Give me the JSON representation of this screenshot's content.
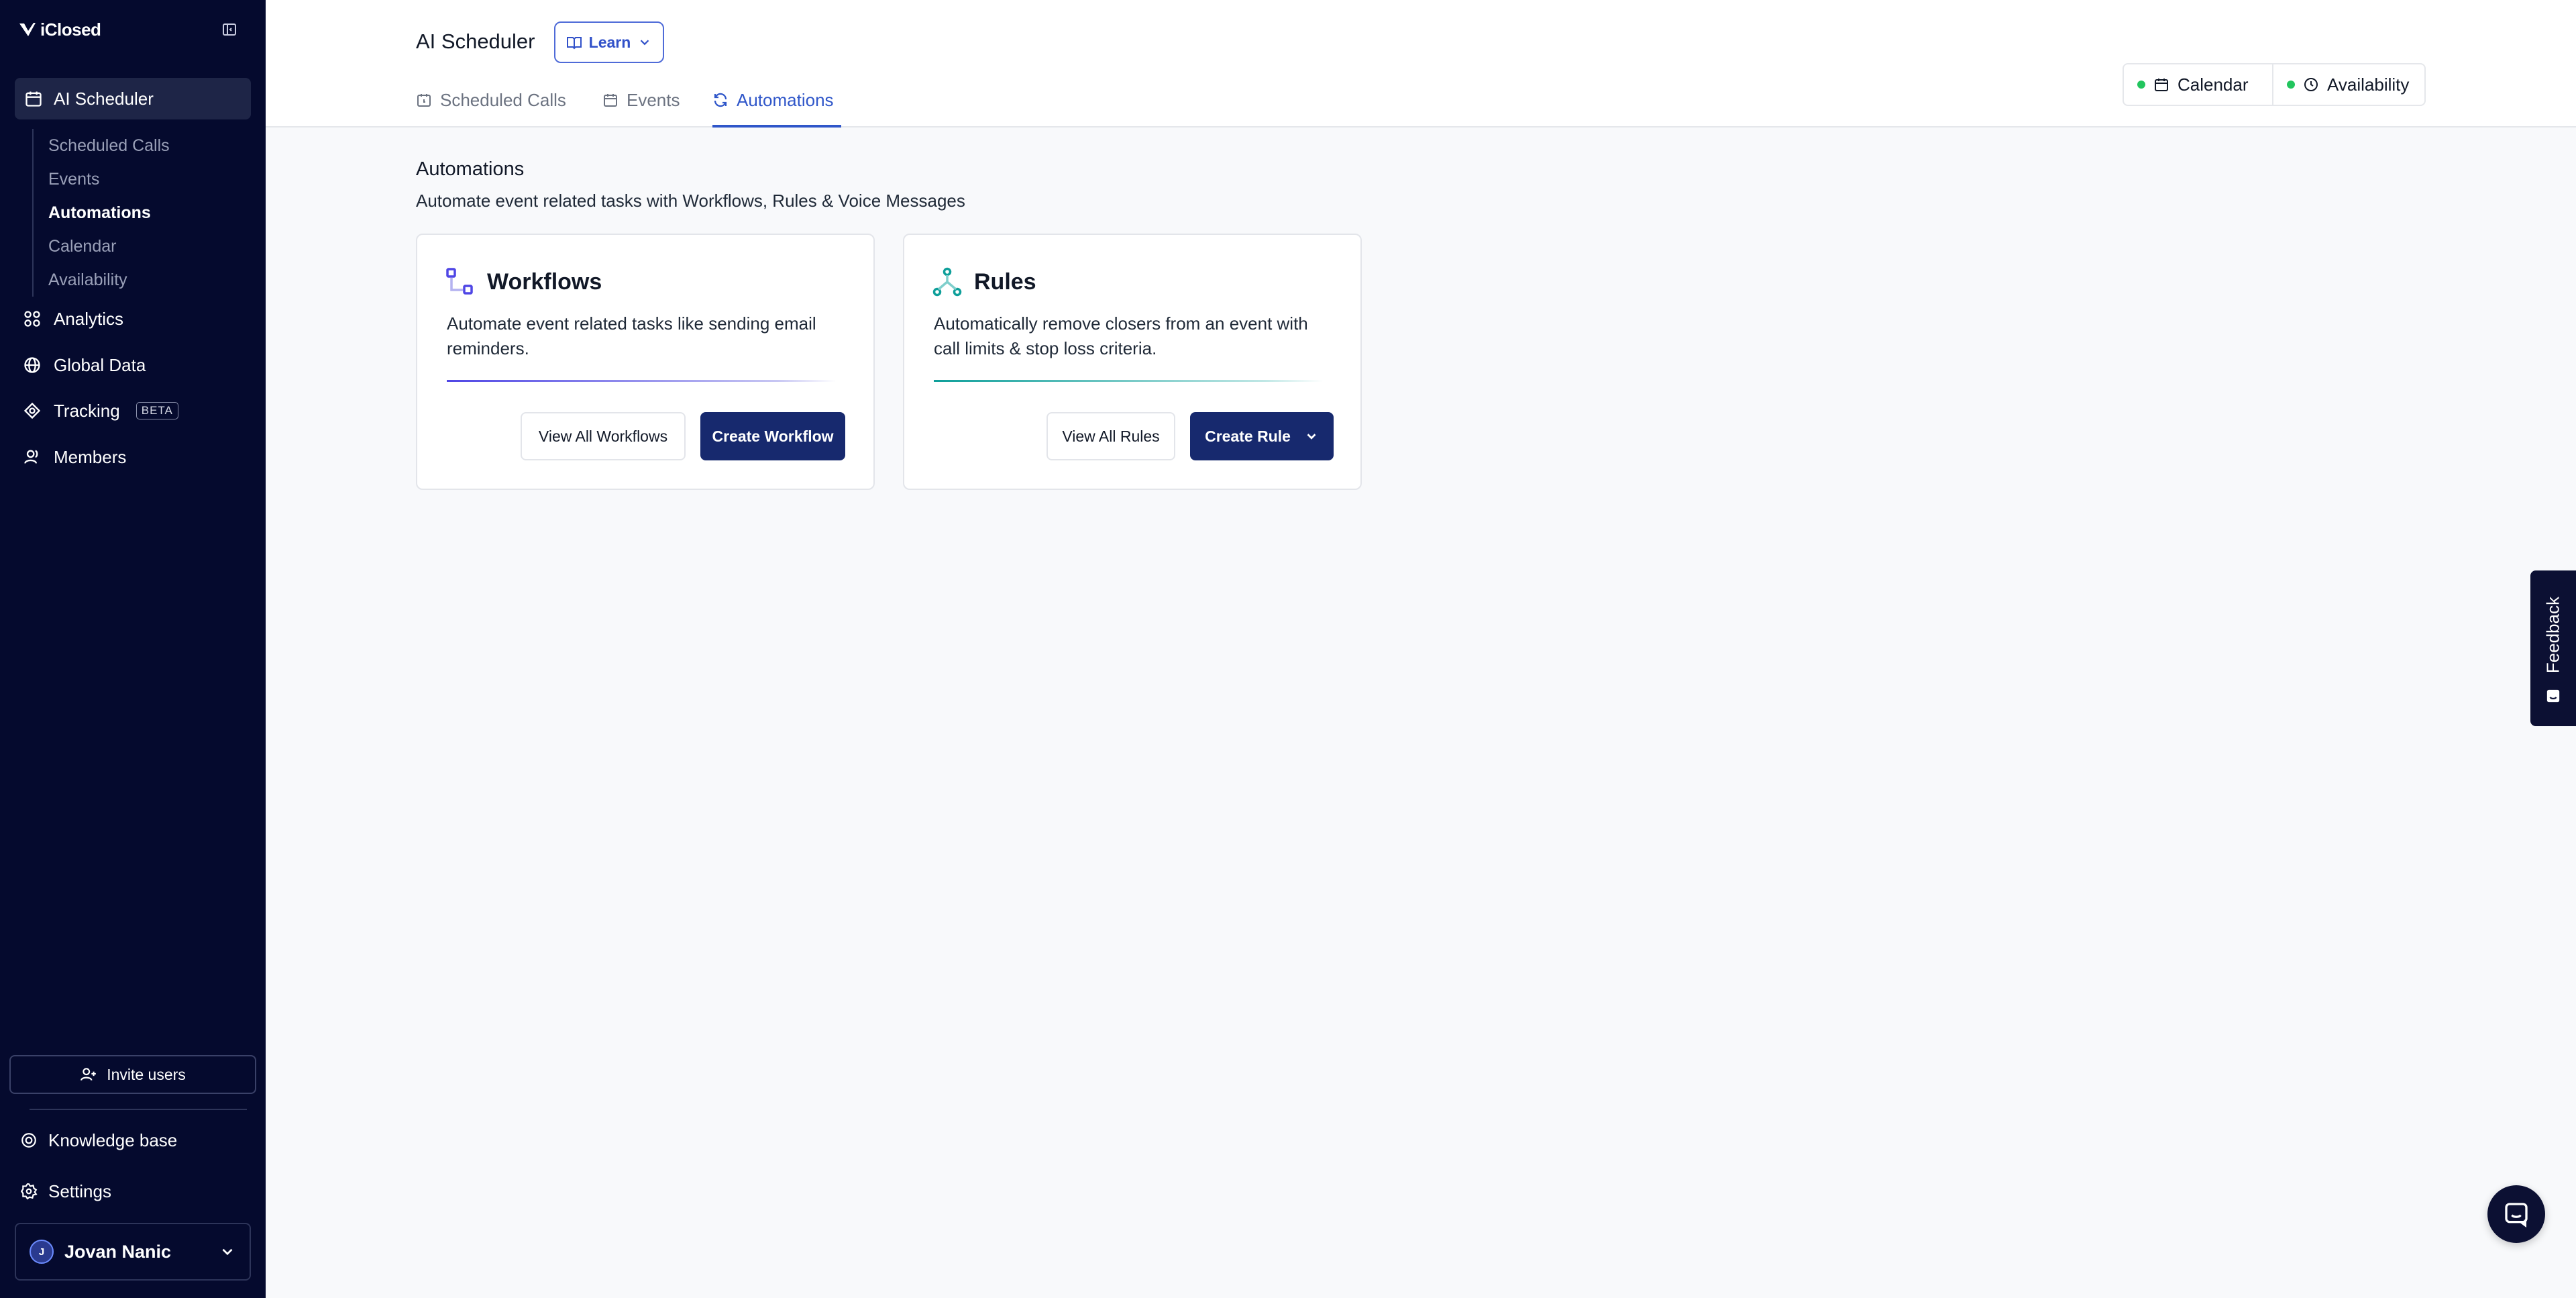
{
  "app": {
    "brand": "iClosed"
  },
  "sidebar": {
    "active_section": {
      "label": "AI Scheduler",
      "icon": "calendar-icon"
    },
    "sub_items": [
      {
        "label": "Scheduled Calls",
        "active": false
      },
      {
        "label": "Events",
        "active": false
      },
      {
        "label": "Automations",
        "active": true
      },
      {
        "label": "Calendar",
        "active": false
      },
      {
        "label": "Availability",
        "active": false
      }
    ],
    "items": [
      {
        "label": "Analytics",
        "icon": "grid-icon"
      },
      {
        "label": "Global Data",
        "icon": "globe-icon"
      },
      {
        "label": "Tracking",
        "icon": "target-icon",
        "badge": "BETA"
      },
      {
        "label": "Members",
        "icon": "users-icon"
      }
    ],
    "invite_label": "Invite users",
    "knowledge_base_label": "Knowledge base",
    "settings_label": "Settings",
    "user": {
      "initial": "J",
      "name": "Jovan Nanic"
    }
  },
  "header": {
    "title": "AI Scheduler",
    "learn_label": "Learn",
    "tabs": [
      {
        "label": "Scheduled Calls",
        "active": false
      },
      {
        "label": "Events",
        "active": false
      },
      {
        "label": "Automations",
        "active": true
      }
    ],
    "toolbar": {
      "calendar_label": "Calendar",
      "availability_label": "Availability",
      "status_color": "#22c55e"
    }
  },
  "main": {
    "title": "Automations",
    "subtitle": "Automate event related tasks with Workflows, Rules & Voice Messages",
    "cards": [
      {
        "title": "Workflows",
        "description": "Automate event related tasks like sending email reminders.",
        "secondary_label": "View All Workflows",
        "primary_label": "Create Workflow",
        "accent": "#4f46e5"
      },
      {
        "title": "Rules",
        "description": "Automatically remove closers from an event with call limits & stop loss criteria.",
        "secondary_label": "View All Rules",
        "primary_label": "Create Rule",
        "accent": "#0e9f9a"
      }
    ]
  },
  "feedback_label": "Feedback",
  "colors": {
    "sidebar_bg": "#050a2e",
    "primary": "#17296e",
    "tab_active": "#2f56c9"
  }
}
